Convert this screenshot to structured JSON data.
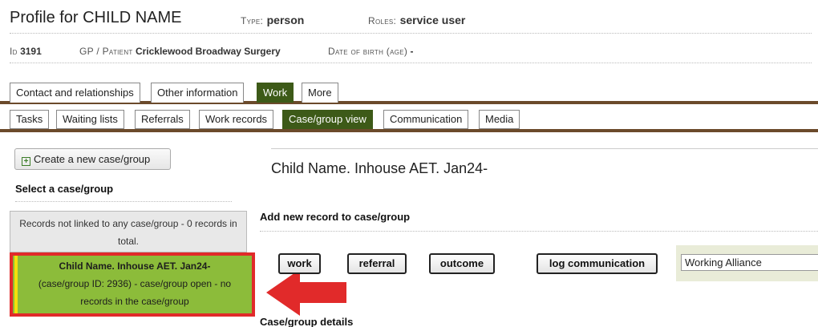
{
  "header": {
    "title": "Profile for CHILD NAME",
    "type_label": "Type:",
    "type_value": "person",
    "roles_label": "Roles:",
    "roles_value": "service user"
  },
  "info": {
    "id_label": "Id",
    "id_value": "3191",
    "gp_label": "GP / Patient",
    "gp_value": "Cricklewood Broadway Surgery",
    "dob_label": "Date of birth (age)",
    "dob_value": "-"
  },
  "tabs": [
    "Contact and relationships",
    "Other information",
    "Work",
    "More"
  ],
  "subtabs": [
    "Tasks",
    "Waiting lists",
    "Referrals",
    "Work records",
    "Case/group view",
    "Communication",
    "Media"
  ],
  "sidebar": {
    "create_label": "Create a new case/group",
    "select_heading": "Select a case/group",
    "unlinked_text": "Records not linked to any case/group - 0 records in total.",
    "case_title": "Child Name. Inhouse AET. Jan24-",
    "case_detail": "(case/group ID: 2936) - case/group open - no records in the case/group"
  },
  "main": {
    "case_title": "Child Name. Inhouse AET. Jan24-",
    "add_heading": "Add new record to case/group",
    "buttons": [
      "work",
      "referral",
      "outcome",
      "log communication"
    ],
    "select_value": "Working Alliance",
    "details_heading": "Case/group details"
  },
  "colors": {
    "active_tab": "#3d5a18",
    "tab_rule": "#6b4a2b",
    "selected_case": "#8cbc3a",
    "highlight": "#e12a2a"
  }
}
